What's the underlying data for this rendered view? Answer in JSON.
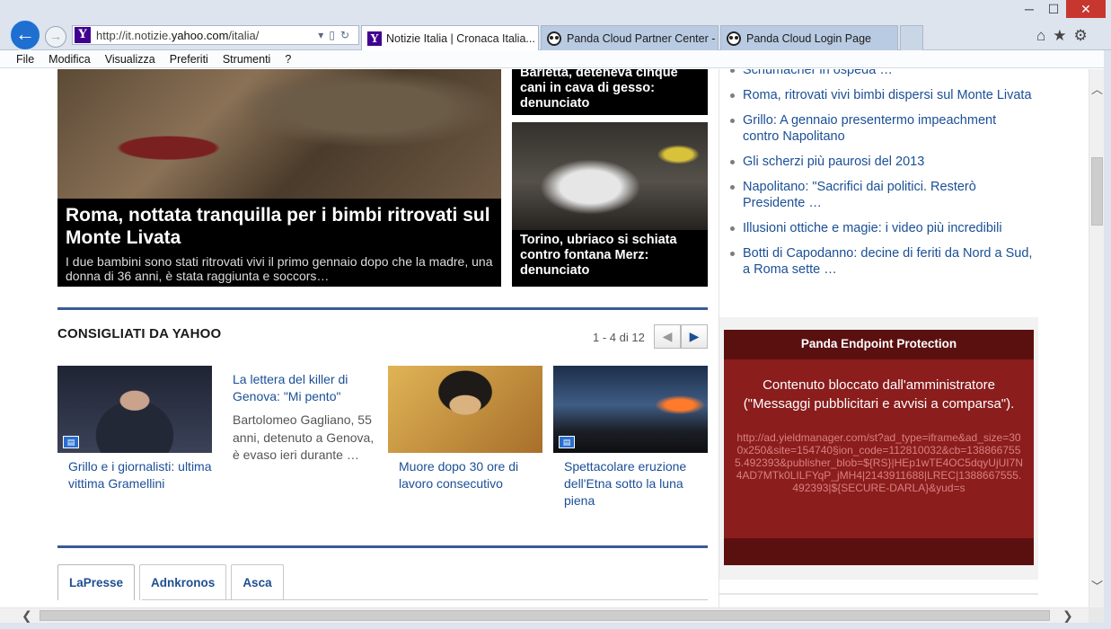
{
  "browser": {
    "url_prefix": "http://it.notizie.",
    "url_domain": "yahoo.com",
    "url_suffix": "/italia/",
    "tabs": [
      {
        "label": "Notizie Italia | Cronaca Italia...",
        "active": true
      },
      {
        "label": "Panda Cloud Partner Center - I...",
        "active": false
      },
      {
        "label": "Panda Cloud Login Page",
        "active": false
      }
    ],
    "menu": [
      "File",
      "Modifica",
      "Visualizza",
      "Preferiti",
      "Strumenti",
      "?"
    ],
    "colors": {
      "chrome": "#dde4ee",
      "back_button": "#1f6fd0",
      "close_button": "#c7372f"
    }
  },
  "hero": {
    "title": "Roma, nottata tranquilla per i bimbi ritrovati sul Monte Livata",
    "summary": "I due bambini sono stati ritrovati vivi il primo gennaio dopo che la madre, una donna di 36 anni, è stata raggiunta e soccors…"
  },
  "side_stories": [
    {
      "title": "Barletta, deteneva cinque cani in cava di gesso: denunciato"
    },
    {
      "title": "Torino, ubriaco si schiata contro fontana Merz: denunciato"
    }
  ],
  "consigliati": {
    "title": "CONSIGLIATI DA YAHOO",
    "pager": "1 - 4 di 12",
    "items": [
      {
        "title": "Grillo e i giornalisti: ultima vittima Gramellini"
      },
      {
        "title": "La lettera del killer di Genova: \"Mi pento\"",
        "body": "Bartolomeo Gagliano, 55 anni, detenuto a Genova, è evaso ieri durante …"
      },
      {
        "title": "Muore dopo 30 ore di lavoro consecutivo"
      },
      {
        "title": "Spettacolare eruzione dell'Etna sotto la luna piena"
      }
    ]
  },
  "source_tabs": [
    "LaPresse",
    "Adnkronos",
    "Asca"
  ],
  "trending": [
    "Schumacher in ospeda …",
    "Roma, ritrovati vivi bimbi dispersi sul Monte Livata",
    "Grillo: A gennaio presentermo impeachment contro Napolitano",
    "Gli scherzi più paurosi del 2013",
    "Napolitano: \"Sacrifici dai politici. Resterò Presidente …",
    "Illusioni ottiche e magie: i video più incredibili",
    "Botti di Capodanno: decine di feriti da Nord a Sud, a Roma sette …"
  ],
  "ad_block": {
    "header": "Panda Endpoint Protection",
    "message_line1": "Contenuto bloccato dall'amministratore",
    "message_line2": "(\"Messaggi pubblicitari e avvisi a comparsa\").",
    "blocked_url": "http://ad.yieldmanager.com/st?ad_type=iframe&ad_size=300x250&site=154740§ion_code=112810032&cb=1388667555.492393&publisher_blob=${RS}|HEp1wTE4OC5dqyUjUI7N4AD7MTk0LILFYqP_jMH4|2143911688|LREC|1388667555.492393|${SECURE-DARLA}&yud=s",
    "colors": {
      "body": "#8b1d1d",
      "header": "#5b1010"
    }
  },
  "icons": {
    "back": "←",
    "forward": "→",
    "dropdown": "▾",
    "refresh": "↻",
    "home": "⌂",
    "favorites": "★",
    "tools": "⚙",
    "pager_prev": "◀",
    "pager_next": "▶",
    "scroll_up": "︿",
    "scroll_down": "﹀",
    "scroll_left": "❮",
    "scroll_right": "❯"
  }
}
